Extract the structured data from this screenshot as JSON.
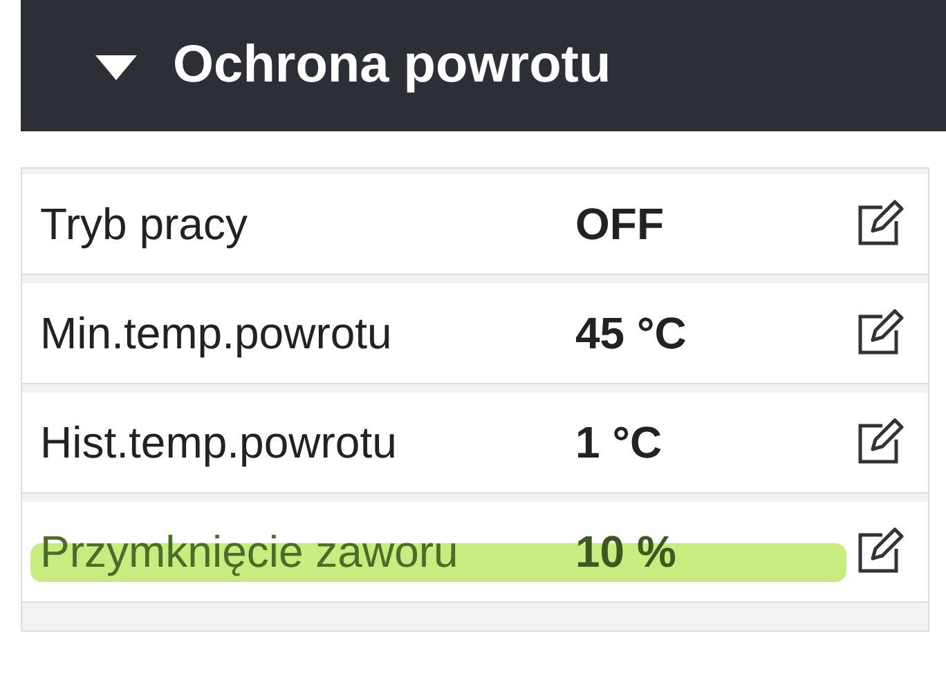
{
  "section": {
    "title": "Ochrona powrotu",
    "expanded": true
  },
  "rows": [
    {
      "label": "Tryb pracy",
      "value": "OFF",
      "highlighted": false
    },
    {
      "label": "Min.temp.powrotu",
      "value": "45 °C",
      "highlighted": false
    },
    {
      "label": "Hist.temp.powrotu",
      "value": "1 °C",
      "highlighted": false
    },
    {
      "label": "Przymknięcie zaworu",
      "value": "10 %",
      "highlighted": true
    }
  ]
}
